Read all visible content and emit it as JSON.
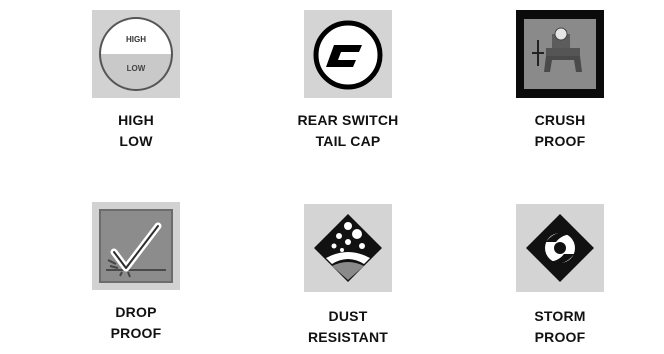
{
  "features": [
    {
      "icon": "high-low-mode-icon",
      "icon_text": {
        "high": "HIGH",
        "low": "LOW"
      },
      "label_line1": "HIGH",
      "label_line2": "LOW"
    },
    {
      "icon": "rear-switch-icon",
      "label_line1": "REAR SWITCH",
      "label_line2": "TAIL CAP"
    },
    {
      "icon": "crush-proof-icon",
      "label_line1": "CRUSH",
      "label_line2": "PROOF"
    },
    {
      "icon": "drop-proof-icon",
      "label_line1": "DROP",
      "label_line2": "PROOF"
    },
    {
      "icon": "dust-resistant-icon",
      "label_line1": "DUST",
      "label_line2": "RESISTANT"
    },
    {
      "icon": "storm-proof-icon",
      "label_line1": "STORM",
      "label_line2": "PROOF"
    }
  ]
}
